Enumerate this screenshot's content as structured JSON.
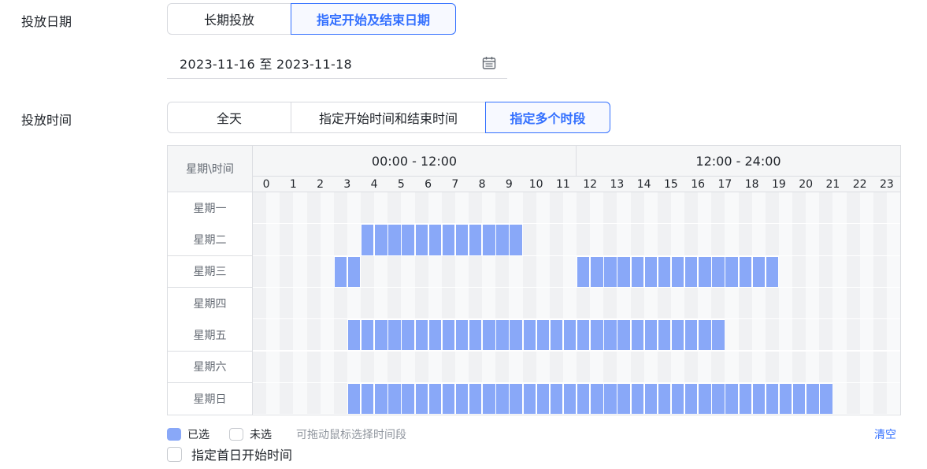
{
  "delivery_date": {
    "label": "投放日期",
    "options": [
      {
        "label": "长期投放",
        "active": false
      },
      {
        "label": "指定开始及结束日期",
        "active": true
      }
    ],
    "date_range": "2023-11-16 至 2023-11-18"
  },
  "delivery_time": {
    "label": "投放时间",
    "options": [
      {
        "label": "全天",
        "active": false
      },
      {
        "label": "指定开始时间和结束时间",
        "active": false
      },
      {
        "label": "指定多个时段",
        "active": true
      }
    ]
  },
  "schedule": {
    "corner_label": "星期\\时间",
    "halves": [
      "00:00 - 12:00",
      "12:00 - 24:00"
    ],
    "hours": [
      "0",
      "1",
      "2",
      "3",
      "4",
      "5",
      "6",
      "7",
      "8",
      "9",
      "10",
      "11",
      "12",
      "13",
      "14",
      "15",
      "16",
      "17",
      "18",
      "19",
      "20",
      "21",
      "22",
      "23"
    ],
    "days": [
      {
        "label": "星期一",
        "selected_slots": []
      },
      {
        "label": "星期二",
        "selected_slots": [
          [
            8,
            19
          ]
        ]
      },
      {
        "label": "星期三",
        "selected_slots": [
          [
            6,
            7
          ],
          [
            24,
            38
          ]
        ]
      },
      {
        "label": "星期四",
        "selected_slots": []
      },
      {
        "label": "星期五",
        "selected_slots": [
          [
            7,
            34
          ]
        ]
      },
      {
        "label": "星期六",
        "selected_slots": []
      },
      {
        "label": "星期日",
        "selected_slots": [
          [
            7,
            42
          ]
        ]
      }
    ],
    "colors": {
      "selected": "#89a8f8",
      "stripe_a": "#f0f1f3",
      "stripe_b": "#f8f9fa"
    }
  },
  "legend": {
    "selected_label": "已选",
    "unselected_label": "未选",
    "hint": "可拖动鼠标选择时间段",
    "clear_label": "清空"
  },
  "first_day_checkbox": {
    "label": "指定首日开始时间",
    "checked": false
  },
  "accent_color": "#3370ff"
}
